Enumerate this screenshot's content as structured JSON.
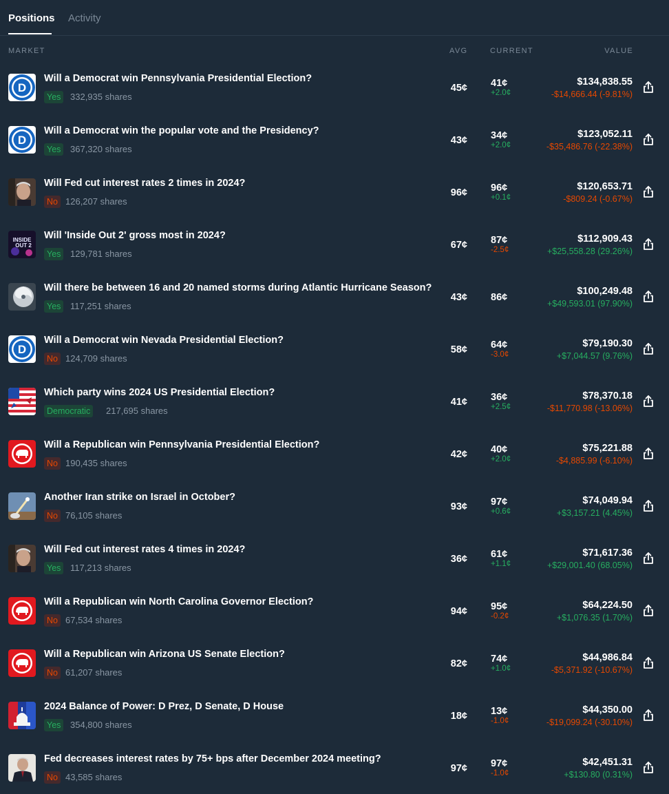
{
  "tabs": [
    {
      "label": "Positions",
      "active": true
    },
    {
      "label": "Activity",
      "active": false
    }
  ],
  "headers": {
    "market": "MARKET",
    "avg": "AVG",
    "current": "CURRENT",
    "value": "VALUE"
  },
  "colors": {
    "background": "#1d2b39",
    "positive": "#27ae60",
    "negative": "#e64800",
    "muted": "#7b8997"
  },
  "positions": [
    {
      "icon": "democrat-icon",
      "title": "Will a Democrat win Pennsylvania Presidential Election?",
      "outcome": "Yes",
      "shares": "332,935 shares",
      "avg": "45¢",
      "current": "41¢",
      "change": "+2.0¢",
      "value": "$134,838.55",
      "pnl": "-$14,666.44 (-9.81%)"
    },
    {
      "icon": "democrat-icon",
      "title": "Will a Democrat win the popular vote and the Presidency?",
      "outcome": "Yes",
      "shares": "367,320 shares",
      "avg": "43¢",
      "current": "34¢",
      "change": "+2.0¢",
      "value": "$123,052.11",
      "pnl": "-$35,486.76 (-22.38%)"
    },
    {
      "icon": "fed-chair-photo",
      "title": "Will Fed cut interest rates 2 times in 2024?",
      "outcome": "No",
      "shares": "126,207 shares",
      "avg": "96¢",
      "current": "96¢",
      "change": "+0.1¢",
      "value": "$120,653.71",
      "pnl": "-$809.24 (-0.67%)"
    },
    {
      "icon": "movie-poster-photo",
      "title": "Will 'Inside Out 2' gross most in 2024?",
      "outcome": "Yes",
      "shares": "129,781 shares",
      "avg": "67¢",
      "current": "87¢",
      "change": "-2.5¢",
      "value": "$112,909.43",
      "pnl": "+$25,558.28 (29.26%)"
    },
    {
      "icon": "hurricane-photo",
      "title": "Will there be between 16 and 20 named storms during Atlantic Hurricane Season?",
      "outcome": "Yes",
      "shares": "117,251 shares",
      "avg": "43¢",
      "current": "86¢",
      "change": "",
      "value": "$100,249.48",
      "pnl": "+$49,593.01 (97.90%)"
    },
    {
      "icon": "democrat-icon",
      "title": "Will a Democrat win Nevada Presidential Election?",
      "outcome": "No",
      "shares": "124,709 shares",
      "avg": "58¢",
      "current": "64¢",
      "change": "-3.0¢",
      "value": "$79,190.30",
      "pnl": "+$7,044.57 (9.76%)"
    },
    {
      "icon": "party-flag-icon",
      "title": "Which party wins 2024 US Presidential Election?",
      "outcome": "Democratic",
      "shares": "217,695 shares",
      "avg": "41¢",
      "current": "36¢",
      "change": "+2.5¢",
      "value": "$78,370.18",
      "pnl": "-$11,770.98 (-13.06%)"
    },
    {
      "icon": "republican-icon",
      "title": "Will a Republican win Pennsylvania Presidential Election?",
      "outcome": "No",
      "shares": "190,435 shares",
      "avg": "42¢",
      "current": "40¢",
      "change": "+2.0¢",
      "value": "$75,221.88",
      "pnl": "-$4,885.99 (-6.10%)"
    },
    {
      "icon": "missile-photo",
      "title": "Another Iran strike on Israel in October?",
      "outcome": "No",
      "shares": "76,105 shares",
      "avg": "93¢",
      "current": "97¢",
      "change": "+0.6¢",
      "value": "$74,049.94",
      "pnl": "+$3,157.21 (4.45%)"
    },
    {
      "icon": "fed-chair-photo",
      "title": "Will Fed cut interest rates 4 times in 2024?",
      "outcome": "Yes",
      "shares": "117,213 shares",
      "avg": "36¢",
      "current": "61¢",
      "change": "+1.1¢",
      "value": "$71,617.36",
      "pnl": "+$29,001.40 (68.05%)"
    },
    {
      "icon": "republican-icon",
      "title": "Will a Republican win North Carolina Governor Election?",
      "outcome": "No",
      "shares": "67,534 shares",
      "avg": "94¢",
      "current": "95¢",
      "change": "-0.2¢",
      "value": "$64,224.50",
      "pnl": "+$1,076.35 (1.70%)"
    },
    {
      "icon": "republican-icon",
      "title": "Will a Republican win Arizona US Senate Election?",
      "outcome": "No",
      "shares": "61,207 shares",
      "avg": "82¢",
      "current": "74¢",
      "change": "+1.0¢",
      "value": "$44,986.84",
      "pnl": "-$5,371.92 (-10.67%)"
    },
    {
      "icon": "capitol-photo",
      "title": "2024 Balance of Power: D Prez, D Senate, D House",
      "outcome": "Yes",
      "shares": "354,800 shares",
      "avg": "18¢",
      "current": "13¢",
      "change": "-1.0¢",
      "value": "$44,350.00",
      "pnl": "-$19,099.24 (-30.10%)"
    },
    {
      "icon": "fed-chair-suit-photo",
      "title": "Fed decreases interest rates by 75+ bps after December 2024 meeting?",
      "outcome": "No",
      "shares": "43,585 shares",
      "avg": "97¢",
      "current": "97¢",
      "change": "-1.0¢",
      "value": "$42,451.31",
      "pnl": "+$130.80 (0.31%)"
    }
  ]
}
